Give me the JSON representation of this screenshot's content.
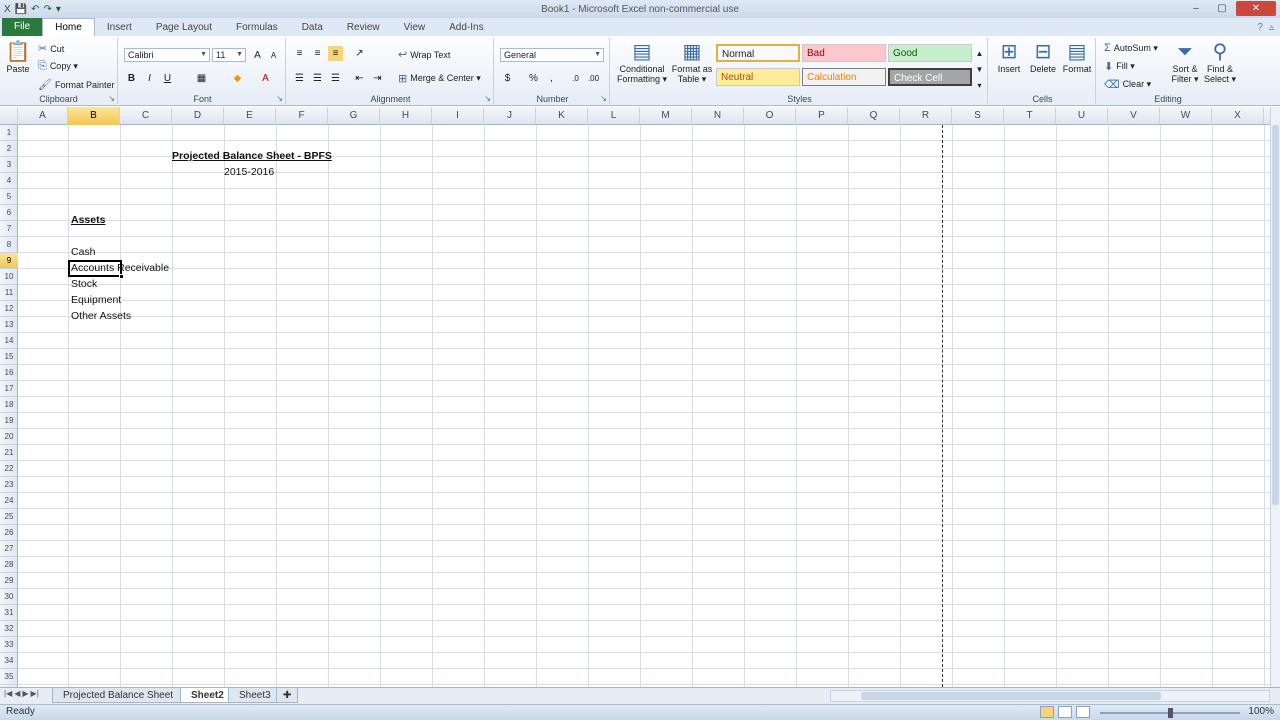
{
  "titlebar": {
    "title": "Book1 - Microsoft Excel non-commercial use",
    "qat": [
      "X",
      "💾",
      "↶",
      "↷",
      "▾"
    ],
    "buttons": [
      "–",
      "▢",
      "✕"
    ]
  },
  "tabs": {
    "items": [
      "File",
      "Home",
      "Insert",
      "Page Layout",
      "Formulas",
      "Data",
      "Review",
      "View",
      "Add-Ins"
    ],
    "active": "Home"
  },
  "ribbon": {
    "clipboard": {
      "label": "Clipboard",
      "paste": "Paste",
      "cut": "Cut",
      "copy": "Copy ▾",
      "format_painter": "Format Painter"
    },
    "font": {
      "label": "Font",
      "name": "Calibri",
      "size": "11",
      "bold": "B",
      "italic": "I",
      "underline": "U"
    },
    "alignment": {
      "label": "Alignment",
      "wrap": "Wrap Text",
      "merge": "Merge & Center ▾"
    },
    "number": {
      "label": "Number",
      "format": "General"
    },
    "styles": {
      "label": "Styles",
      "conditional": "Conditional Formatting ▾",
      "format_table": "Format as Table ▾",
      "cells": [
        {
          "name": "Normal",
          "bg": "#ffffff",
          "color": "#000000"
        },
        {
          "name": "Bad",
          "bg": "#ffc7ce",
          "color": "#9c0006"
        },
        {
          "name": "Good",
          "bg": "#c6efce",
          "color": "#006100"
        },
        {
          "name": "Neutral",
          "bg": "#ffeb9c",
          "color": "#9c5700"
        },
        {
          "name": "Calculation",
          "bg": "#f2f2f2",
          "color": "#fa7d00"
        },
        {
          "name": "Check Cell",
          "bg": "#a5a5a5",
          "color": "#ffffff"
        }
      ]
    },
    "cells_group": {
      "label": "Cells",
      "insert": "Insert",
      "delete": "Delete",
      "format": "Format"
    },
    "editing": {
      "label": "Editing",
      "autosum": "AutoSum ▾",
      "fill": "Fill ▾",
      "clear": "Clear ▾",
      "sort": "Sort & Filter ▾",
      "find": "Find & Select ▾"
    }
  },
  "sheet": {
    "columns": [
      "A",
      "B",
      "C",
      "D",
      "E",
      "F",
      "G",
      "H",
      "I",
      "J",
      "K",
      "L",
      "M",
      "N",
      "O",
      "P",
      "Q",
      "R",
      "S",
      "T",
      "U",
      "V",
      "W",
      "X"
    ],
    "selected_column": "B",
    "rows": [
      "1",
      "2",
      "3",
      "4",
      "5",
      "6",
      "7",
      "8",
      "9",
      "10",
      "11",
      "12",
      "13",
      "14",
      "15",
      "16",
      "17",
      "18",
      "19",
      "20",
      "21",
      "22",
      "23",
      "24",
      "25",
      "26",
      "27",
      "28",
      "29",
      "30",
      "31",
      "32",
      "33",
      "34",
      "35"
    ],
    "selected_row": "9",
    "cells": {
      "title": "Projected Balance Sheet - BPFS",
      "period": "2015-2016",
      "assets": "Assets",
      "cash": "Cash",
      "ar": "Accounts Receivable",
      "stock": "Stock",
      "equipment": "Equipment",
      "other": "Other Assets"
    }
  },
  "sheettabs": {
    "items": [
      "Projected Balance Sheet",
      "Sheet2",
      "Sheet3"
    ],
    "active": "Sheet2"
  },
  "status": {
    "ready": "Ready",
    "zoom": "100%"
  }
}
